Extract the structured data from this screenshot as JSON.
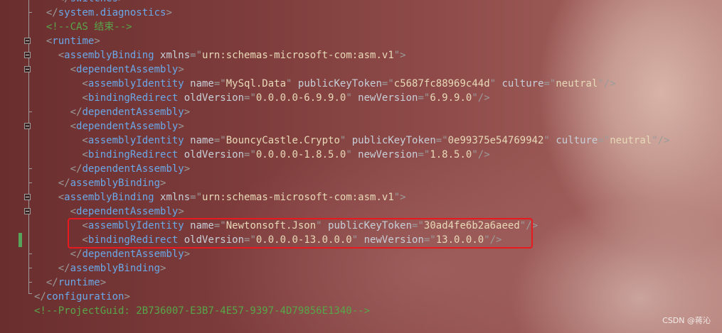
{
  "colors": {
    "tag": "#6aa8e8",
    "attribute": "#c7cfd8",
    "value": "#e8d9b8",
    "comment": "#57a64a",
    "punctuation": "#9b9b9b",
    "highlight": "#e8191f",
    "change_marker": "#58a35a"
  },
  "lines": [
    [
      [
        "p",
        "    </"
      ],
      [
        "t",
        "switches"
      ],
      [
        "p",
        ">"
      ]
    ],
    [
      [
        "p",
        "  </"
      ],
      [
        "t",
        "system.diagnostics"
      ],
      [
        "p",
        ">"
      ]
    ],
    [
      [
        "c",
        "  <!--CAS 结束-->"
      ]
    ],
    [
      [
        "p",
        "  <"
      ],
      [
        "t",
        "runtime"
      ],
      [
        "p",
        ">"
      ]
    ],
    [
      [
        "p",
        "    <"
      ],
      [
        "t",
        "assemblyBinding"
      ],
      [
        "a",
        " xmlns"
      ],
      [
        "p",
        "=\""
      ],
      [
        "v",
        "urn:schemas-microsoft-com:asm.v1"
      ],
      [
        "p",
        "\">"
      ]
    ],
    [
      [
        "p",
        "      <"
      ],
      [
        "t",
        "dependentAssembly"
      ],
      [
        "p",
        ">"
      ]
    ],
    [
      [
        "p",
        "        <"
      ],
      [
        "t",
        "assemblyIdentity"
      ],
      [
        "a",
        " name"
      ],
      [
        "p",
        "=\""
      ],
      [
        "v",
        "MySql.Data"
      ],
      [
        "p",
        "\""
      ],
      [
        "a",
        " publicKeyToken"
      ],
      [
        "p",
        "=\""
      ],
      [
        "v",
        "c5687fc88969c44d"
      ],
      [
        "p",
        "\""
      ],
      [
        "a",
        " culture"
      ],
      [
        "p",
        "=\""
      ],
      [
        "v",
        "neutral"
      ],
      [
        "p",
        "\"/>"
      ]
    ],
    [
      [
        "p",
        "        <"
      ],
      [
        "t",
        "bindingRedirect"
      ],
      [
        "a",
        " oldVersion"
      ],
      [
        "p",
        "=\""
      ],
      [
        "v",
        "0.0.0.0-6.9.9.0"
      ],
      [
        "p",
        "\""
      ],
      [
        "a",
        " newVersion"
      ],
      [
        "p",
        "=\""
      ],
      [
        "v",
        "6.9.9.0"
      ],
      [
        "p",
        "\"/>"
      ]
    ],
    [
      [
        "p",
        "      </"
      ],
      [
        "t",
        "dependentAssembly"
      ],
      [
        "p",
        ">"
      ]
    ],
    [
      [
        "p",
        "      <"
      ],
      [
        "t",
        "dependentAssembly"
      ],
      [
        "p",
        ">"
      ]
    ],
    [
      [
        "p",
        "        <"
      ],
      [
        "t",
        "assemblyIdentity"
      ],
      [
        "a",
        " name"
      ],
      [
        "p",
        "=\""
      ],
      [
        "v",
        "BouncyCastle.Crypto"
      ],
      [
        "p",
        "\""
      ],
      [
        "a",
        " publicKeyToken"
      ],
      [
        "p",
        "=\""
      ],
      [
        "v",
        "0e99375e54769942"
      ],
      [
        "p",
        "\""
      ],
      [
        "a",
        " culture"
      ],
      [
        "p",
        "=\""
      ],
      [
        "v",
        "neutral"
      ],
      [
        "p",
        "\"/>"
      ]
    ],
    [
      [
        "p",
        "        <"
      ],
      [
        "t",
        "bindingRedirect"
      ],
      [
        "a",
        " oldVersion"
      ],
      [
        "p",
        "=\""
      ],
      [
        "v",
        "0.0.0.0-1.8.5.0"
      ],
      [
        "p",
        "\""
      ],
      [
        "a",
        " newVersion"
      ],
      [
        "p",
        "=\""
      ],
      [
        "v",
        "1.8.5.0"
      ],
      [
        "p",
        "\"/>"
      ]
    ],
    [
      [
        "p",
        "      </"
      ],
      [
        "t",
        "dependentAssembly"
      ],
      [
        "p",
        ">"
      ]
    ],
    [
      [
        "p",
        "    </"
      ],
      [
        "t",
        "assemblyBinding"
      ],
      [
        "p",
        ">"
      ]
    ],
    [
      [
        "p",
        "    <"
      ],
      [
        "t",
        "assemblyBinding"
      ],
      [
        "a",
        " xmlns"
      ],
      [
        "p",
        "=\""
      ],
      [
        "v",
        "urn:schemas-microsoft-com:asm.v1"
      ],
      [
        "p",
        "\">"
      ]
    ],
    [
      [
        "p",
        "      <"
      ],
      [
        "t",
        "dependentAssembly"
      ],
      [
        "p",
        ">"
      ]
    ],
    [
      [
        "p",
        "        <"
      ],
      [
        "t",
        "assemblyIdentity"
      ],
      [
        "a",
        " name"
      ],
      [
        "p",
        "=\""
      ],
      [
        "v",
        "Newtonsoft.Json"
      ],
      [
        "p",
        "\""
      ],
      [
        "a",
        " publicKeyToken"
      ],
      [
        "p",
        "=\""
      ],
      [
        "v",
        "30ad4fe6b2a6aeed"
      ],
      [
        "p",
        "\"/>"
      ]
    ],
    [
      [
        "p",
        "        <"
      ],
      [
        "t",
        "bindingRedirect"
      ],
      [
        "a",
        " oldVersion"
      ],
      [
        "p",
        "=\""
      ],
      [
        "v",
        "0.0.0.0-13.0.0.0"
      ],
      [
        "p",
        "\""
      ],
      [
        "a",
        " newVersion"
      ],
      [
        "p",
        "=\""
      ],
      [
        "v",
        "13.0.0.0"
      ],
      [
        "p",
        "\"/>"
      ]
    ],
    [
      [
        "p",
        "      </"
      ],
      [
        "t",
        "dependentAssembly"
      ],
      [
        "p",
        ">"
      ]
    ],
    [
      [
        "p",
        "    </"
      ],
      [
        "t",
        "assemblyBinding"
      ],
      [
        "p",
        ">"
      ]
    ],
    [
      [
        "p",
        "  </"
      ],
      [
        "t",
        "runtime"
      ],
      [
        "p",
        ">"
      ]
    ],
    [
      [
        "p",
        "</"
      ],
      [
        "t",
        "configuration"
      ],
      [
        "p",
        ">"
      ]
    ],
    [
      [
        "c",
        "<!--ProjectGuid: 2B736007-E3B7-4E57-9397-4D79856E1340-->"
      ]
    ]
  ],
  "watermark": "CSDN @蒋沁"
}
